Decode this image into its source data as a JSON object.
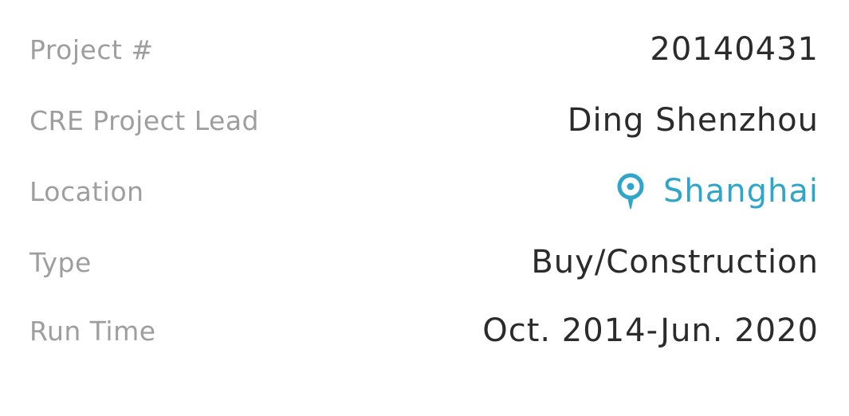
{
  "details": {
    "project_number": {
      "label": "Project #",
      "value": "20140431"
    },
    "project_lead": {
      "label": "CRE Project Lead",
      "value": "Ding Shenzhou"
    },
    "location": {
      "label": "Location",
      "value": "Shanghai",
      "icon": "location-pin-icon",
      "color": "#2ea5c9"
    },
    "type": {
      "label": "Type",
      "value": "Buy/Construction"
    },
    "run_time": {
      "label": "Run Time",
      "value": "Oct. 2014-Jun. 2020"
    }
  }
}
